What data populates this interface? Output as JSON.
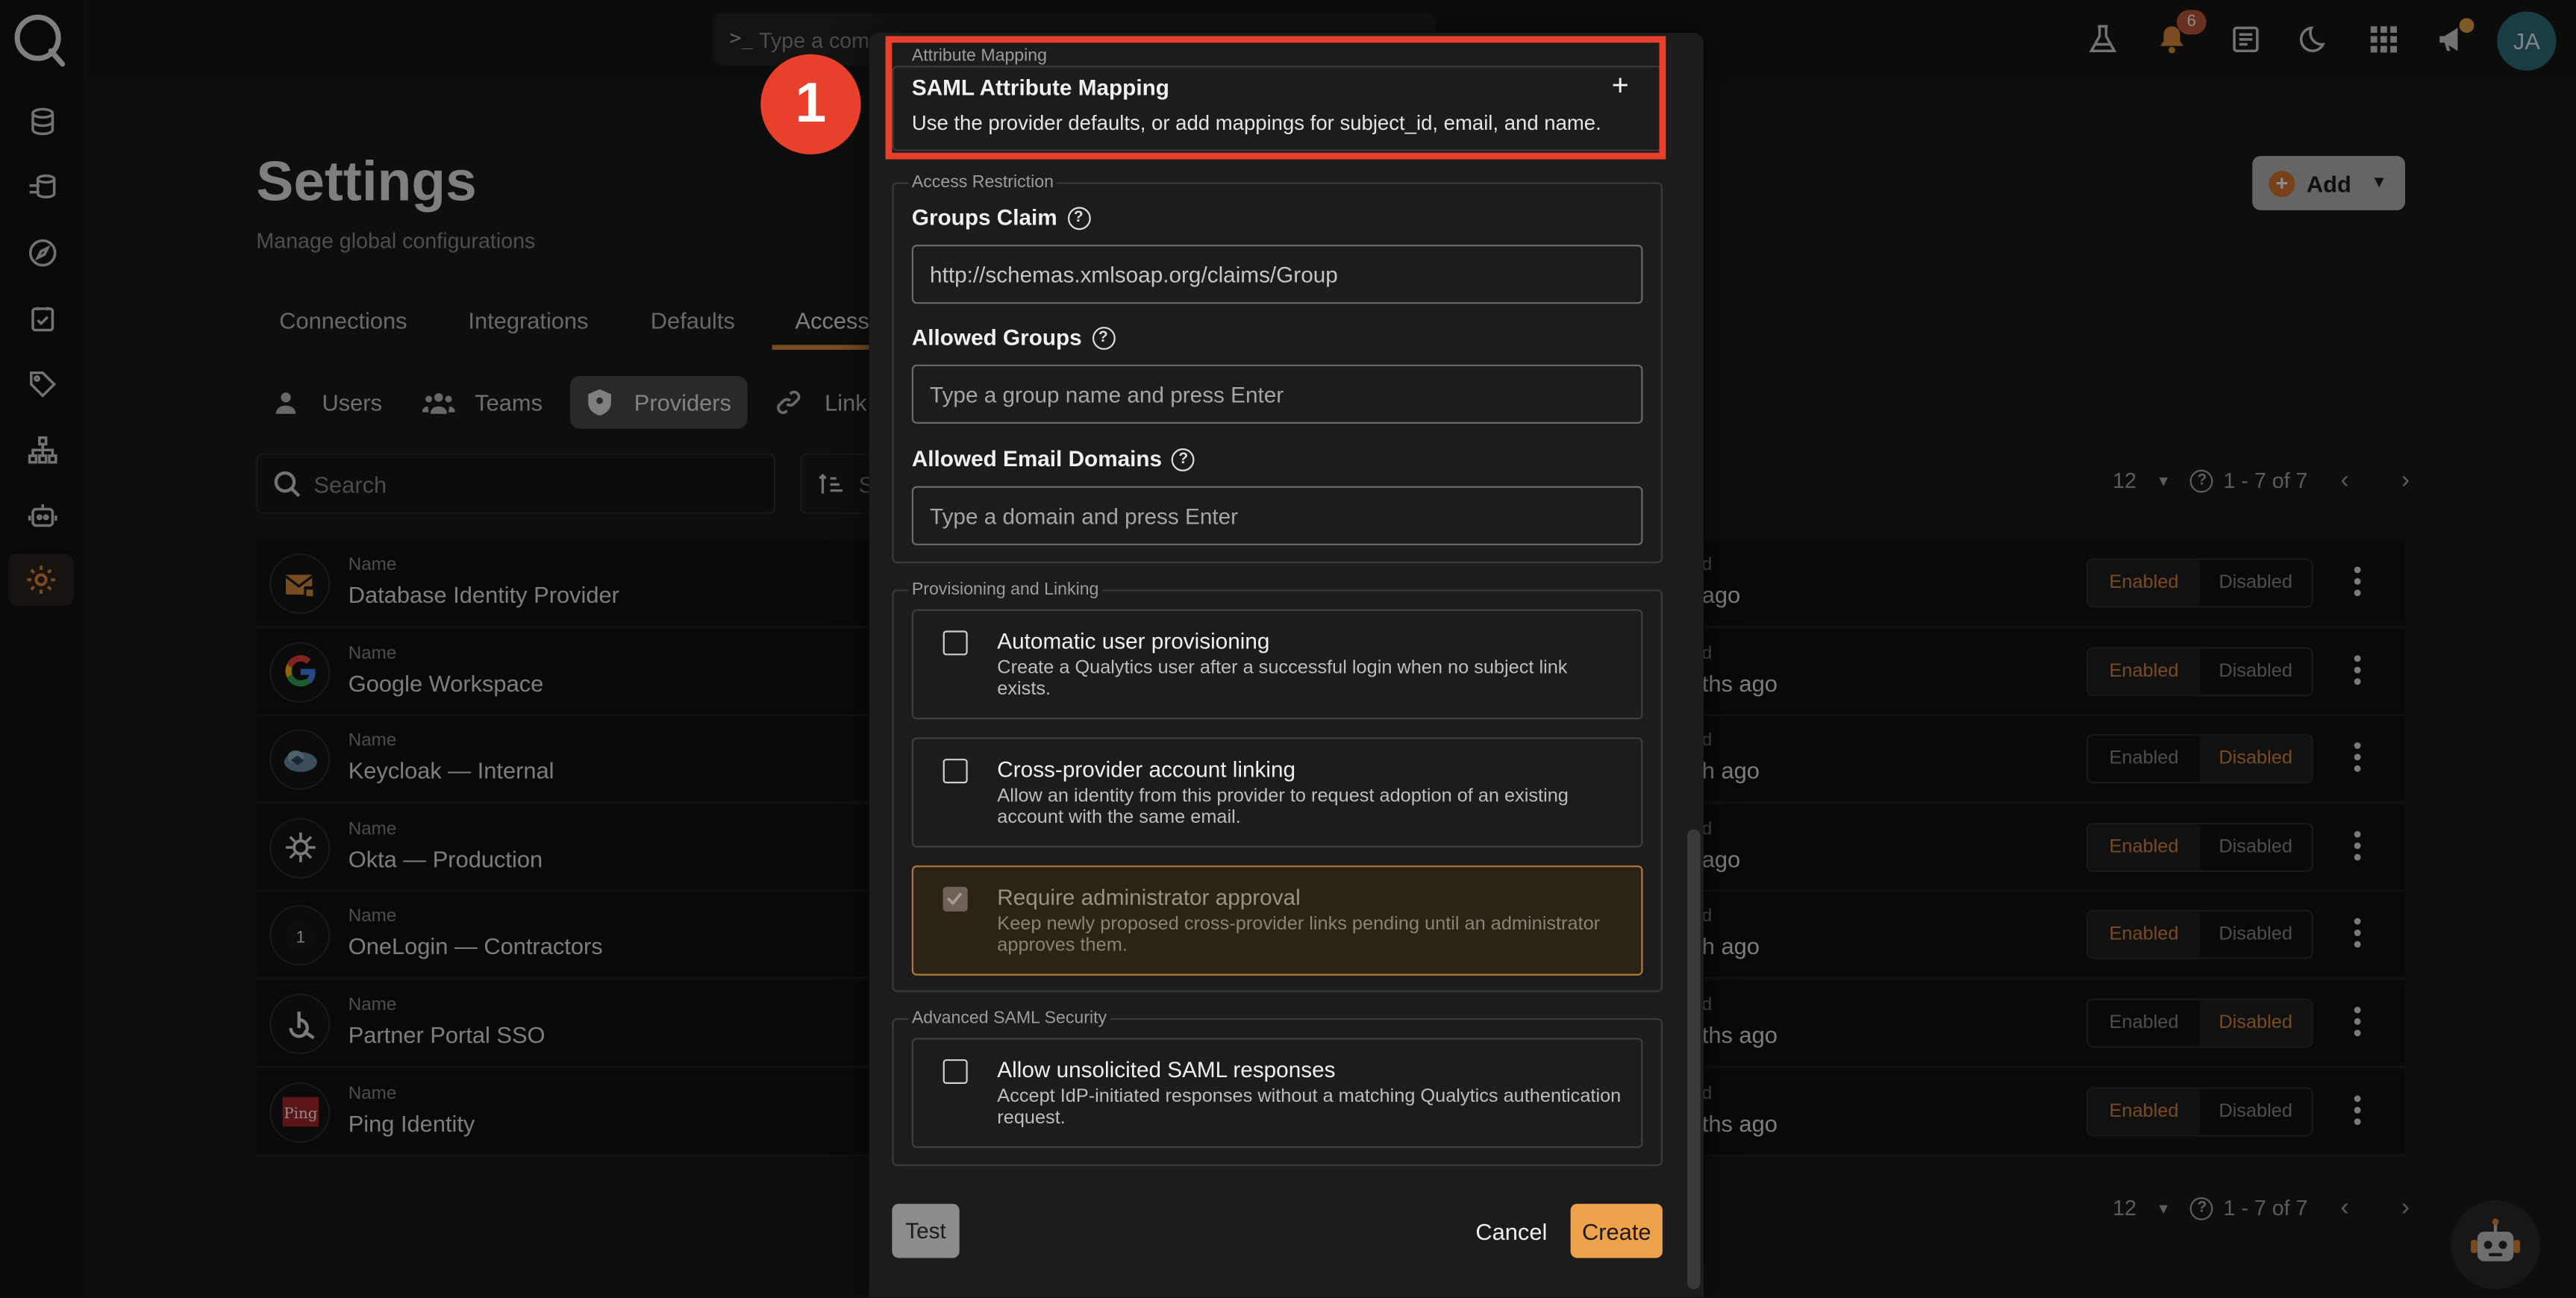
{
  "topbar": {
    "command_placeholder": "Type a comm",
    "notification_count": "6",
    "avatar_initials": "JA"
  },
  "page": {
    "title": "Settings",
    "subtitle": "Manage global configurations",
    "tabs": [
      "Connections",
      "Integrations",
      "Defaults",
      "Access"
    ],
    "active_tab": "Access",
    "add_label": "Add",
    "subnav": [
      "Users",
      "Teams",
      "Providers",
      "Link"
    ],
    "active_subnav": "Providers",
    "search_placeholder": "Search",
    "sort_label": "S",
    "page_size": "12",
    "range": "1 - 7 of 7",
    "column_name_label": "Name",
    "column_date_label": "d",
    "toggle_enabled": "Enabled",
    "toggle_disabled": "Disabled",
    "providers": [
      {
        "name": "Database Identity Provider",
        "ago": "ago",
        "state": "enabled"
      },
      {
        "name": "Google Workspace",
        "ago": "ths ago",
        "state": "enabled"
      },
      {
        "name": "Keycloak — Internal",
        "ago": "h ago",
        "state": "disabled"
      },
      {
        "name": "Okta — Production",
        "ago": "ago",
        "state": "enabled"
      },
      {
        "name": "OneLogin — Contractors",
        "ago": "h ago",
        "state": "enabled"
      },
      {
        "name": "Partner Portal SSO",
        "ago": "ths ago",
        "state": "disabled"
      },
      {
        "name": "Ping Identity",
        "ago": "ths ago",
        "state": "enabled"
      }
    ]
  },
  "modal": {
    "attr_legend": "Attribute Mapping",
    "attr_title": "SAML Attribute Mapping",
    "attr_desc": "Use the provider defaults, or add mappings for subject_id, email, and name.",
    "access_legend": "Access Restriction",
    "groups_claim_label": "Groups Claim",
    "groups_claim_value": "http://schemas.xmlsoap.org/claims/Group",
    "allowed_groups_label": "Allowed Groups",
    "allowed_groups_placeholder": "Type a group name and press Enter",
    "allowed_domains_label": "Allowed Email Domains",
    "allowed_domains_placeholder": "Type a domain and press Enter",
    "prov_legend": "Provisioning and Linking",
    "auto_prov_title": "Automatic user provisioning",
    "auto_prov_desc": "Create a Qualytics user after a successful login when no subject link exists.",
    "cross_link_title": "Cross-provider account linking",
    "cross_link_desc": "Allow an identity from this provider to request adoption of an existing account with the same email.",
    "approval_title": "Require administrator approval",
    "approval_desc": "Keep newly proposed cross-provider links pending until an administrator approves them.",
    "adv_legend": "Advanced SAML Security",
    "unsolicited_title": "Allow unsolicited SAML responses",
    "unsolicited_desc": "Accept IdP-initiated responses without a matching Qualytics authentication request.",
    "test_label": "Test",
    "cancel_label": "Cancel",
    "create_label": "Create"
  },
  "annotation": {
    "step": "1"
  },
  "colors": {
    "accent": "#f0a24a",
    "annotation": "#e8402a"
  }
}
